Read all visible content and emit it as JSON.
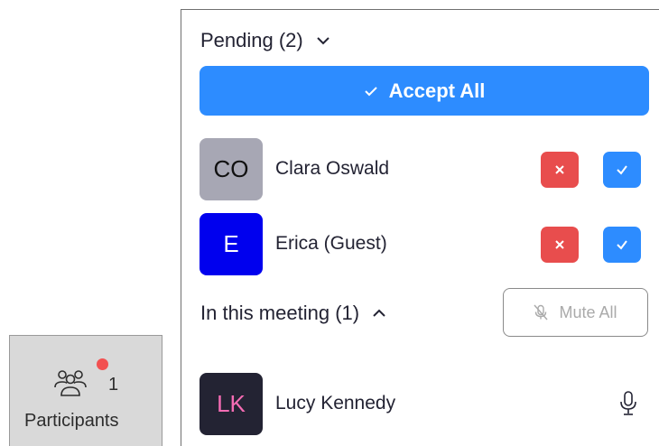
{
  "toolbar": {
    "participants_label": "Participants",
    "participants_count": "1",
    "notification_color": "#f25151",
    "icon": "participants-icon"
  },
  "panel": {
    "pending": {
      "title": "Pending (2)",
      "expanded": true,
      "accept_all_label": "Accept All",
      "accent_color": "#2d8cff",
      "people": [
        {
          "initials": "CO",
          "name": "Clara Oswald",
          "avatar_bg": "#a7a7b4",
          "avatar_fg": "#111111"
        },
        {
          "initials": "E",
          "name": "Erica (Guest)",
          "avatar_bg": "#0000ee",
          "avatar_fg": "#ffffff"
        }
      ],
      "deny_color": "#e84d4d"
    },
    "meeting": {
      "title": "In this meeting (1)",
      "expanded": true,
      "mute_all_label": "Mute All",
      "people": [
        {
          "initials": "LK",
          "name": "Lucy Kennedy",
          "avatar_bg": "#232333",
          "avatar_fg": "#f56cb4",
          "mic": "microphone-icon"
        }
      ]
    }
  }
}
